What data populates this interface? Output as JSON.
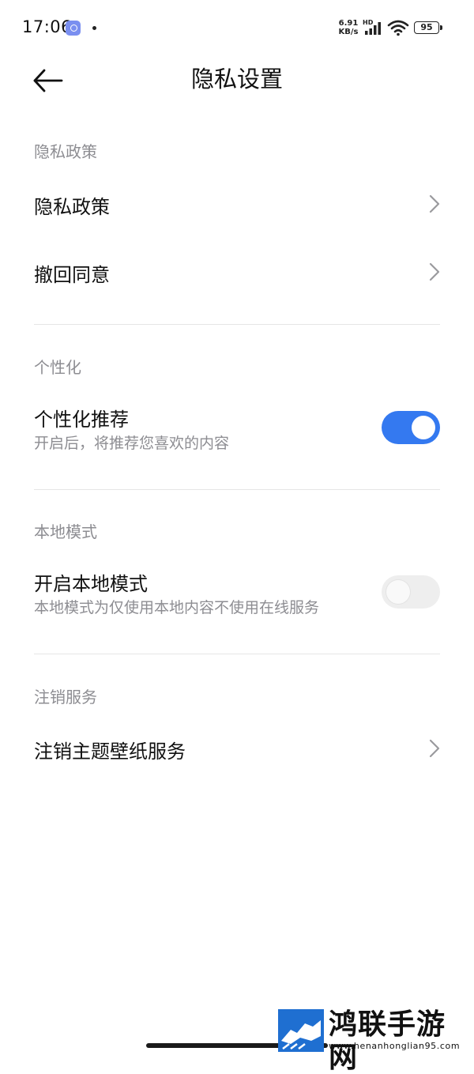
{
  "status_bar": {
    "time": "17:06",
    "net_speed_value": "6.91",
    "net_speed_unit": "KB/s",
    "network_type": "HD",
    "battery_level": "95",
    "icons": [
      "app-notification-icon",
      "signal-icon",
      "wifi-icon",
      "battery-icon"
    ]
  },
  "header": {
    "title": "隐私设置",
    "back_icon": "back-arrow-icon"
  },
  "sections": {
    "privacy": {
      "title": "隐私政策",
      "items": [
        {
          "label": "隐私政策"
        },
        {
          "label": "撤回同意"
        }
      ]
    },
    "personalization": {
      "title": "个性化",
      "item": {
        "label": "个性化推荐",
        "description": "开启后，将推荐您喜欢的内容",
        "enabled": true
      }
    },
    "local_mode": {
      "title": "本地模式",
      "item": {
        "label": "开启本地模式",
        "description": "本地模式为仅使用本地内容不使用在线服务",
        "enabled": false
      }
    },
    "deregister": {
      "title": "注销服务",
      "items": [
        {
          "label": "注销主题壁纸服务"
        }
      ]
    }
  },
  "colors": {
    "accent": "#3479f0",
    "secondary_text": "#8d8d92",
    "primary_text": "#111111",
    "divider": "#e6e6e6",
    "toggle_off": "#eeeeee"
  },
  "watermark": {
    "name": "鸿联手游网",
    "url": "www.henanhonglian95.com"
  }
}
